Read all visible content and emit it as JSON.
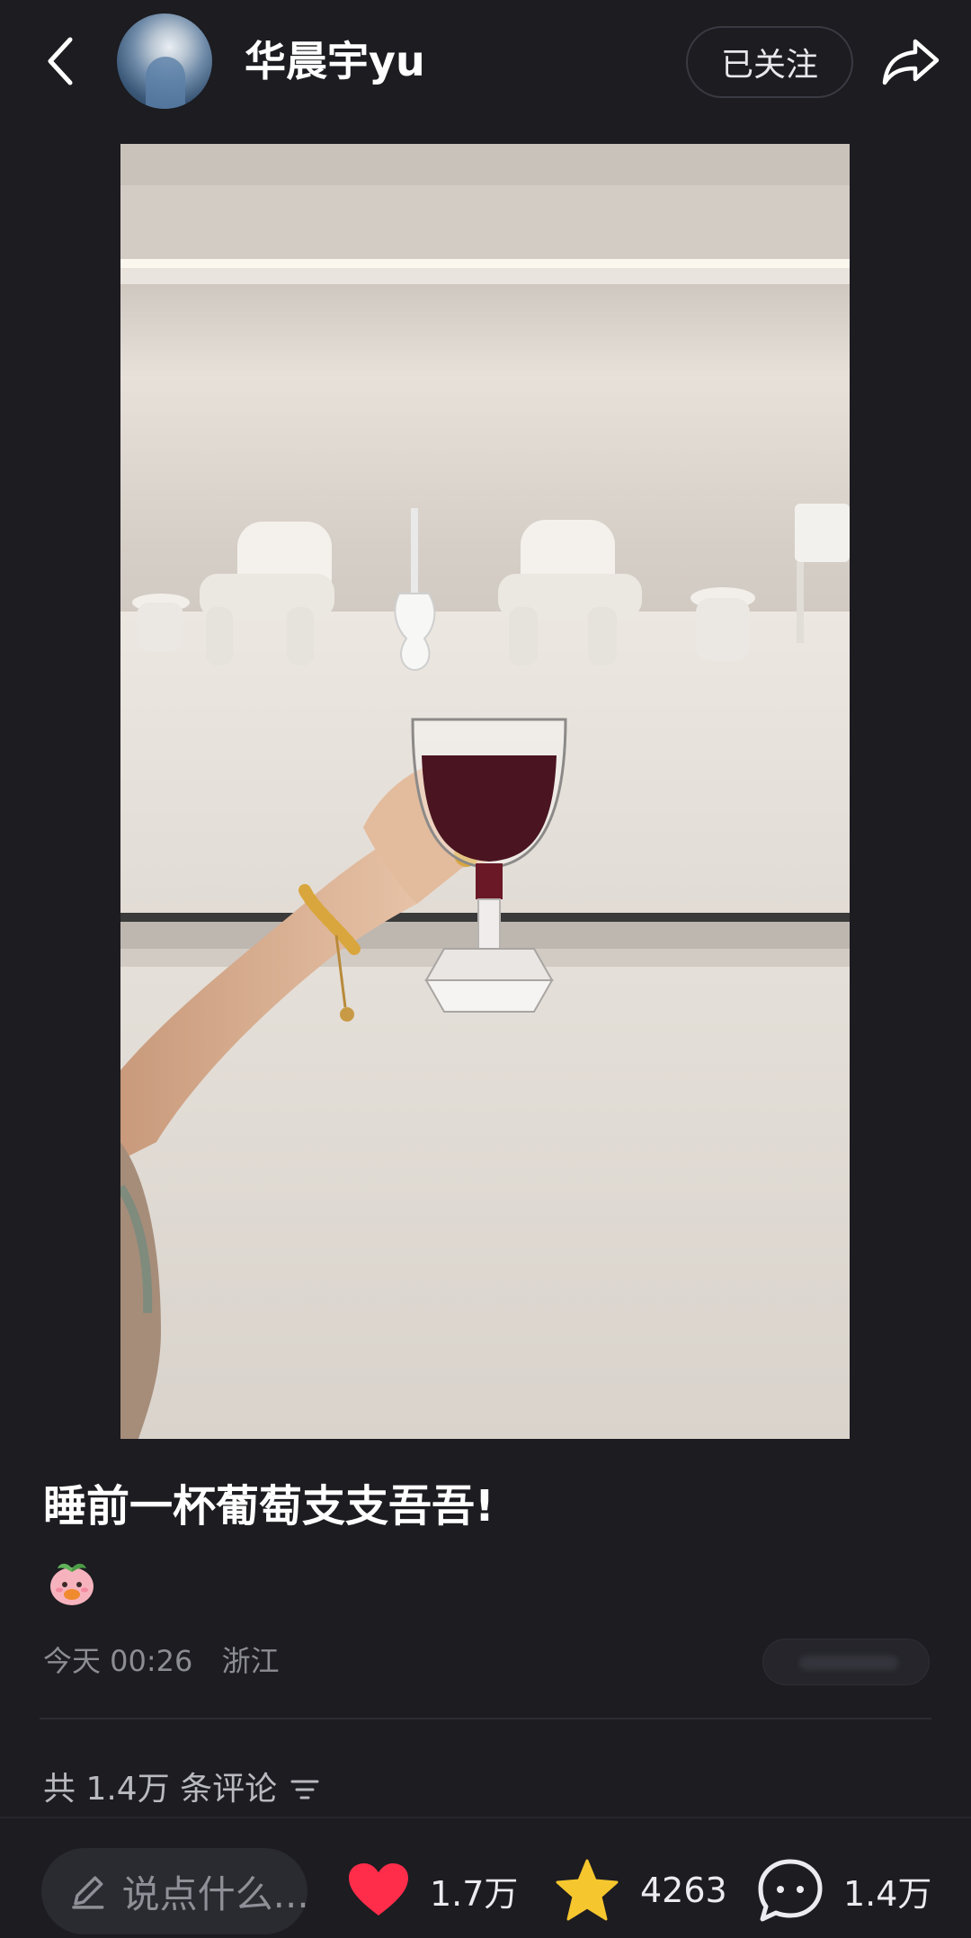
{
  "header": {
    "username": "华晨宇yu",
    "follow_label": "已关注"
  },
  "post": {
    "title": "睡前一杯葡萄支支吾吾!",
    "date": "今天 00:26",
    "location": "浙江"
  },
  "comments": {
    "summary": "共 1.4万 条评论"
  },
  "bottom_bar": {
    "input_placeholder": "说点什么...",
    "likes": "1.7万",
    "favorites": "4263",
    "comments": "1.4万"
  },
  "icons": {
    "back": "chevron-left-icon",
    "share": "share-arrow-icon",
    "emoji": "peach-emoji-icon",
    "sort": "sort-icon",
    "pencil": "pencil-icon",
    "heart": "heart-icon",
    "star": "star-icon",
    "comment": "comment-bubble-icon"
  },
  "colors": {
    "background": "#1c1c21",
    "like_red": "#ff2d4a",
    "star_yellow": "#f6c62e"
  }
}
